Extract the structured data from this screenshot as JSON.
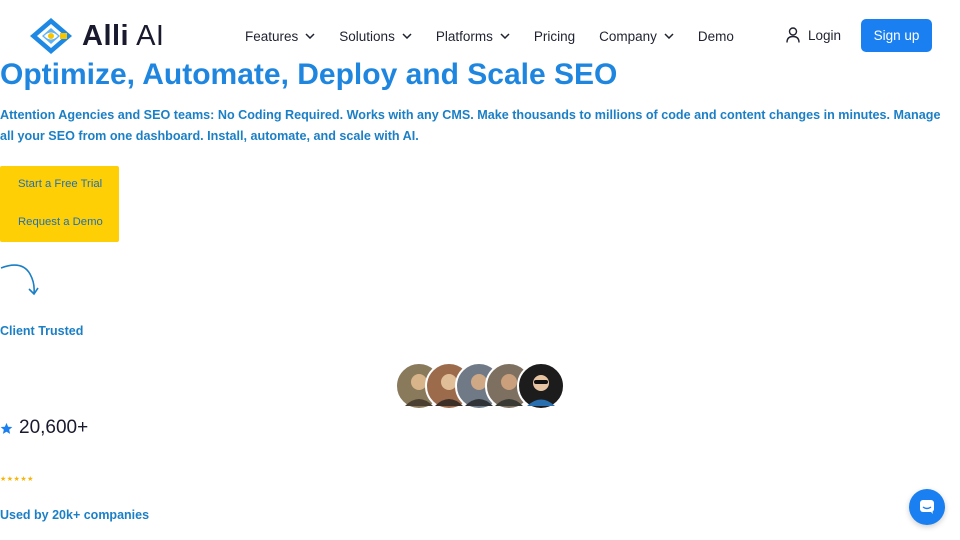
{
  "brand": {
    "name_bold": "Alli",
    "name_rest": " AI"
  },
  "nav": {
    "items": [
      {
        "label": "Features",
        "dropdown": true
      },
      {
        "label": "Solutions",
        "dropdown": true
      },
      {
        "label": "Platforms",
        "dropdown": true
      },
      {
        "label": "Pricing",
        "dropdown": false
      },
      {
        "label": "Company",
        "dropdown": true
      },
      {
        "label": "Demo",
        "dropdown": false
      }
    ],
    "login_label": "Login",
    "signup_label": "Sign up"
  },
  "hero": {
    "title": "Optimize, Automate, Deploy and Scale SEO",
    "subtitle": "Attention Agencies and SEO teams: No Coding Required. Works with any CMS. Make thousands to millions of code and content changes in minutes. Manage all your SEO from one dashboard. Install, automate, and scale with AI.",
    "cta_trial": "Start a Free Trial",
    "cta_demo": "Request a Demo"
  },
  "trust": {
    "client_trusted": "Client Trusted",
    "count": "20,600+",
    "rating_stars": "★★★★★",
    "used_by": "Used by 20k+ companies"
  },
  "colors": {
    "primary": "#1a7ff0",
    "heading": "#1f86e0",
    "cta_bg": "#ffcf06",
    "text_blue": "#1b7fc6"
  },
  "icons": [
    "alli-logo-icon",
    "chevron-down-icon",
    "user-icon",
    "curved-arrow-icon",
    "star-icon",
    "chat-icon"
  ]
}
